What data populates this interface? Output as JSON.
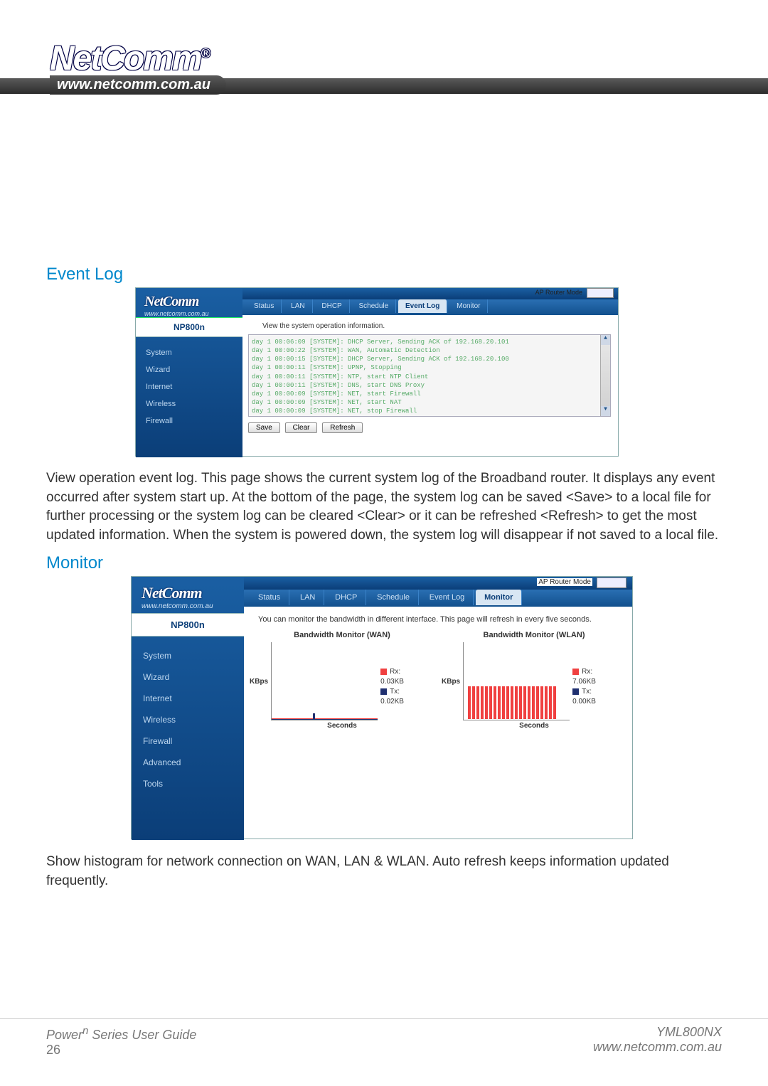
{
  "brand": {
    "name": "NetComm",
    "reg": "®",
    "url": "www.netcomm.com.au"
  },
  "sections": {
    "event_log": "Event Log",
    "monitor": "Monitor"
  },
  "paragraphs": {
    "event_log": "View operation event log. This page shows the current system log of the Broadband router. It displays any event occurred after system start up. At the bottom of the page, the system log can be saved <Save> to a local file for further processing or the system log can be cleared <Clear> or it can be refreshed <Refresh> to get the most updated information. When the system is powered down, the system log will disappear if not saved to a local file.",
    "monitor": "Show histogram for network connection on WAN, LAN & WLAN. Auto refresh keeps information updated frequently."
  },
  "router_ui_common": {
    "mode_label": "AP Router Mode",
    "model": "NP800n",
    "sidebar_url": "www.netcomm.com.au",
    "tabs": [
      "Status",
      "LAN",
      "DHCP",
      "Schedule",
      "Event Log",
      "Monitor"
    ]
  },
  "event_shot": {
    "active_tab": "Event Log",
    "sidebar": [
      "System",
      "Wizard",
      "Internet",
      "Wireless",
      "Firewall"
    ],
    "desc": "View the system operation information.",
    "log_lines": [
      "day  1 00:06:09 [SYSTEM]: DHCP Server, Sending ACK of 192.168.20.101",
      "day  1 00:00:22 [SYSTEM]: WAN, Automatic Detection",
      "day  1 00:00:15 [SYSTEM]: DHCP Server, Sending ACK of 192.168.20.100",
      "day  1 00:00:11 [SYSTEM]: UPNP, Stopping",
      "day  1 00:00:11 [SYSTEM]: NTP, start NTP Client",
      "day  1 00:00:11 [SYSTEM]: DNS, start DNS Proxy",
      "day  1 00:00:09 [SYSTEM]: NET, start Firewall",
      "day  1 00:00:09 [SYSTEM]: NET, start NAT",
      "day  1 00:00:09 [SYSTEM]: NET, stop Firewall"
    ],
    "buttons": {
      "save": "Save",
      "clear": "Clear",
      "refresh": "Refresh"
    }
  },
  "monitor_shot": {
    "active_tab": "Monitor",
    "sidebar": [
      "System",
      "Wizard",
      "Internet",
      "Wireless",
      "Firewall",
      "Advanced",
      "Tools"
    ],
    "desc": "You can monitor the bandwidth in different interface. This page will refresh in every five seconds.",
    "chart_wan": {
      "title": "Bandwidth Monitor (WAN)",
      "ylabel": "KBps",
      "xlabel": "Seconds",
      "legend_rx": "Rx:",
      "legend_rx_v": "0.03KB",
      "legend_tx": "Tx:",
      "legend_tx_v": "0.02KB"
    },
    "chart_wlan": {
      "title": "Bandwidth Monitor (WLAN)",
      "ylabel": "KBps",
      "xlabel": "Seconds",
      "legend_rx": "Rx:",
      "legend_rx_v": "7.06KB",
      "legend_tx": "Tx:",
      "legend_tx_v": "0.00KB"
    },
    "xticks": [
      "10",
      "20",
      "30",
      "40",
      "50"
    ]
  },
  "chart_data": [
    {
      "type": "line",
      "title": "Bandwidth Monitor (WAN)",
      "xlabel": "Seconds",
      "ylabel": "KBps",
      "xlim": [
        0,
        55
      ],
      "ylim": [
        0,
        5
      ],
      "xticks": [
        10,
        20,
        30,
        40,
        50
      ],
      "yticks": [
        0,
        1,
        2,
        3,
        4
      ],
      "series": [
        {
          "name": "Rx",
          "color": "#f04040",
          "value_label": "0.03KB",
          "values": [
            0.03,
            0.03,
            0.03,
            0.03,
            0.03,
            0.03,
            0.03,
            0.03,
            0.03,
            0.03,
            0.03
          ]
        },
        {
          "name": "Tx",
          "color": "#203070",
          "value_label": "0.02KB",
          "values": [
            0.02,
            0.02,
            0.02,
            0.02,
            0.02,
            0.02,
            0.02,
            0.02,
            0.02,
            0.02,
            0.02
          ]
        }
      ],
      "x": [
        5,
        10,
        15,
        20,
        25,
        30,
        35,
        40,
        45,
        50,
        55
      ]
    },
    {
      "type": "bar",
      "title": "Bandwidth Monitor (WLAN)",
      "xlabel": "Seconds",
      "ylabel": "KBps",
      "xlim": [
        0,
        55
      ],
      "ylim": [
        0,
        16
      ],
      "xticks": [
        10,
        20,
        30,
        40,
        50
      ],
      "yticks": [
        2,
        4,
        8,
        12,
        16
      ],
      "series": [
        {
          "name": "Rx",
          "color": "#f04040",
          "value_label": "7.06KB",
          "values": [
            7,
            7,
            7,
            7,
            7,
            7,
            7,
            7,
            7,
            7,
            7,
            7,
            7,
            7,
            7,
            7,
            7,
            7,
            7,
            7,
            7
          ]
        },
        {
          "name": "Tx",
          "color": "#203070",
          "value_label": "0.00KB",
          "values": [
            0,
            0,
            0,
            0,
            0,
            0,
            0,
            0,
            0,
            0,
            0,
            0,
            0,
            0,
            0,
            0,
            0,
            0,
            0,
            0,
            0
          ]
        }
      ],
      "x": [
        5,
        7.5,
        10,
        12.5,
        15,
        17.5,
        20,
        22.5,
        25,
        27.5,
        30,
        32.5,
        35,
        37.5,
        40,
        42.5,
        45,
        47.5,
        50,
        52.5,
        55
      ]
    }
  ],
  "footer": {
    "guide": "Power",
    "guide_sup": "n",
    "guide_tail": " Series User Guide",
    "page": "26",
    "code": "YML800NX",
    "url": "www.netcomm.com.au"
  }
}
